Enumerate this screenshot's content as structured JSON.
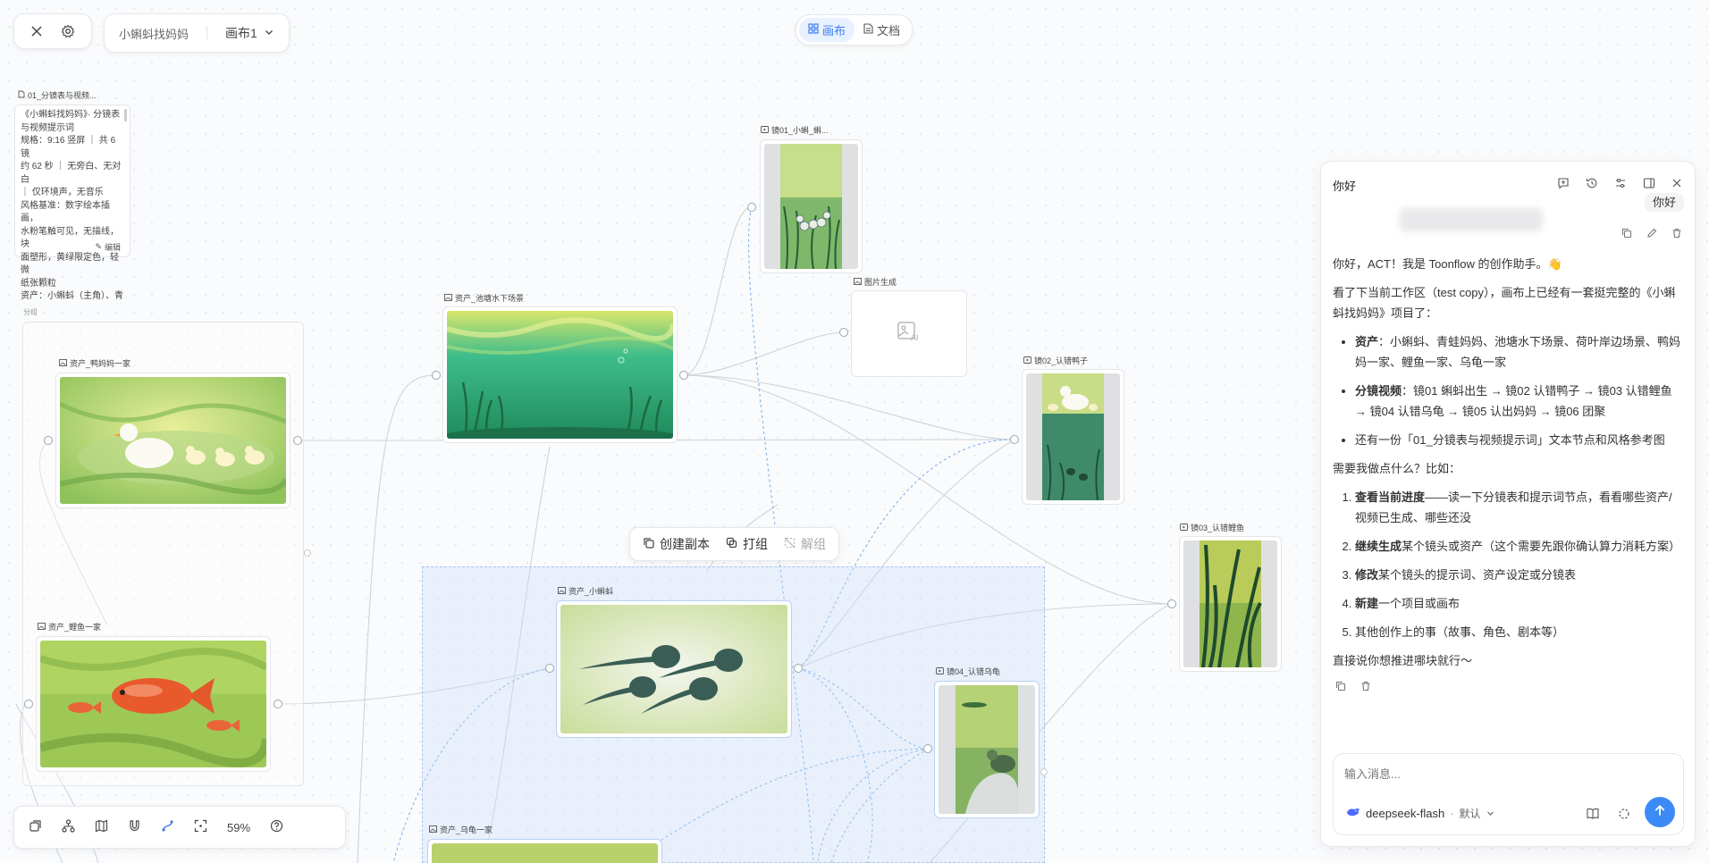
{
  "topbar": {
    "project_name": "小蝌蚪找妈妈",
    "canvas_name": "画布1",
    "mode_canvas": "画布",
    "mode_doc": "文档"
  },
  "nodes": {
    "note_title": "01_分镜表与视频...",
    "note_lines": [
      "《小蝌蚪找妈妈》· 分镜表",
      "与视频提示词",
      "规格：9:16 竖屏 ｜ 共 6 镜",
      "约 62 秒 ｜ 无旁白、无对白",
      "｜ 仅环境声，无音乐",
      "风格基准：数字绘本插画，",
      "水粉笔触可见，无描线，块",
      "面塑形，黄绿限定色，轻微",
      "纸张颗粒",
      "资产：小蝌蚪（主角）、青"
    ],
    "note_edit": "编辑",
    "group_label": "分组",
    "duck_family": "资产_鸭妈妈一家",
    "carp_family": "资产_鲤鱼一家",
    "pond_scene": "资产_池塘水下场景",
    "tadpole": "资产_小蝌蚪",
    "turtle_family": "资产_乌龟一家",
    "shot01": "镜01_小蝌_蝌...",
    "image_gen": "图片生成",
    "shot02": "镜02_认错鸭子",
    "shot03": "镜03_认错鲤鱼",
    "shot04": "镜04_认错乌龟"
  },
  "float_toolbar": {
    "duplicate": "创建副本",
    "group": "打组",
    "ungroup": "解组"
  },
  "bottom_toolbar": {
    "zoom": "59%"
  },
  "chat": {
    "title": "你好",
    "user_message": "你好",
    "greeting": "你好，ACT！我是 Toonflow 的创作助手。👋",
    "intro": "看了下当前工作区（test copy），画布上已经有一套挺完整的《小蝌蚪找妈妈》项目了：",
    "bullets": [
      {
        "bold": "资产",
        "text": "：小蝌蚪、青蛙妈妈、池塘水下场景、荷叶岸边场景、鸭妈妈一家、鲤鱼一家、乌龟一家"
      },
      {
        "bold": "分镜视频",
        "text": "：镜01 蝌蚪出生 → 镜02 认错鸭子 → 镜03 认错鲤鱼 → 镜04 认错乌龟 → 镜05 认出妈妈 → 镜06 团聚"
      },
      {
        "bold": "",
        "text": "还有一份「01_分镜表与视频提示词」文本节点和风格参考图"
      }
    ],
    "question": "需要我做点什么？比如：",
    "options": [
      {
        "bold": "查看当前进度",
        "text": "——读一下分镜表和提示词节点，看看哪些资产/视频已生成、哪些还没"
      },
      {
        "bold": "继续生成",
        "text": "某个镜头或资产（这个需要先跟你确认算力消耗方案）"
      },
      {
        "bold": "修改",
        "text": "某个镜头的提示词、资产设定或分镜表"
      },
      {
        "bold": "新建",
        "text": "一个项目或画布"
      },
      {
        "bold": "",
        "text": "其他创作上的事（故事、角色、剧本等）"
      }
    ],
    "closing": "直接说你想推进哪块就行～",
    "input_placeholder": "输入消息...",
    "model": "deepseek-flash",
    "model_mode": "默认"
  },
  "colors": {
    "accent": "#3b8af5",
    "selection_blue": "#d6e4fa"
  }
}
